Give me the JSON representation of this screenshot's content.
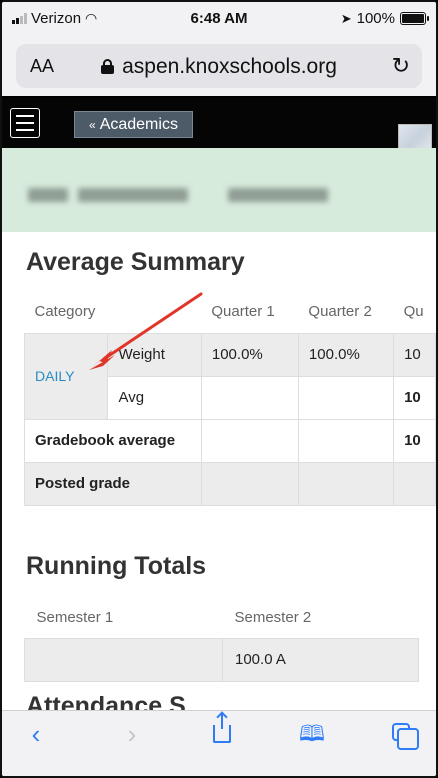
{
  "status_bar": {
    "carrier": "Verizon",
    "time": "6:48 AM",
    "battery": "100%"
  },
  "browser": {
    "text_size": "AA",
    "url": "aspen.knoxschools.org"
  },
  "app_header": {
    "breadcrumb_label": "Academics"
  },
  "average_summary": {
    "title": "Average Summary",
    "headers": [
      "Category",
      "Quarter 1",
      "Quarter 2",
      "Qu"
    ],
    "category": "DAILY",
    "rows": [
      {
        "label": "Weight",
        "q1": "100.0%",
        "q2": "100.0%",
        "q3": "10"
      },
      {
        "label": "Avg",
        "q1": "",
        "q2": "",
        "q3": "10"
      }
    ],
    "gradebook_average": {
      "label": "Gradebook average",
      "q3": "10"
    },
    "posted_grade": {
      "label": "Posted grade"
    }
  },
  "running_totals": {
    "title": "Running Totals",
    "headers": [
      "Semester 1",
      "Semester 2"
    ],
    "values": [
      "",
      "100.0 A"
    ]
  },
  "next_section_title_partial": "Attendance S",
  "colors": {
    "accent_link": "#2a8bc4",
    "annotation_arrow": "#e0362a",
    "green_band": "#d7ebdc",
    "ios_blue": "#2f7df6"
  }
}
